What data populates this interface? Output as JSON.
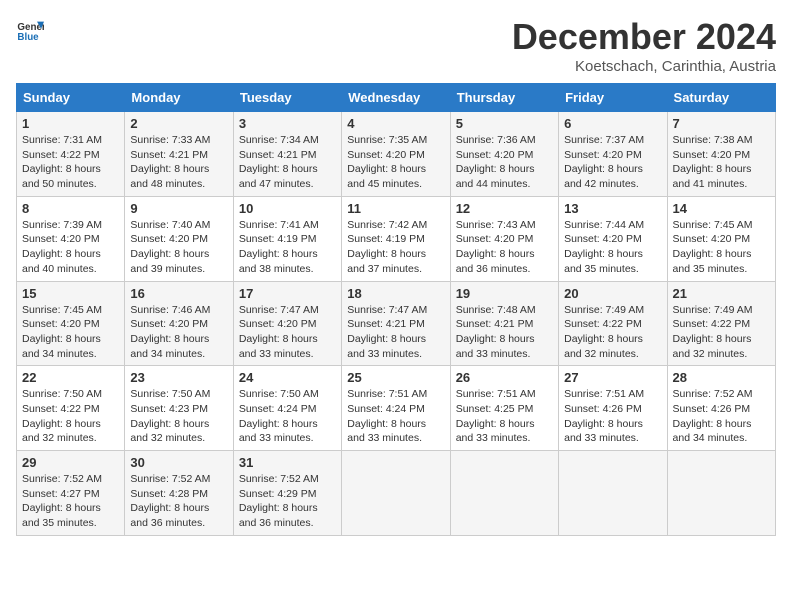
{
  "header": {
    "logo_text_general": "General",
    "logo_text_blue": "Blue",
    "month_title": "December 2024",
    "location": "Koetschach, Carinthia, Austria"
  },
  "days_of_week": [
    "Sunday",
    "Monday",
    "Tuesday",
    "Wednesday",
    "Thursday",
    "Friday",
    "Saturday"
  ],
  "weeks": [
    [
      {
        "day": "1",
        "rise": "Sunrise: 7:31 AM",
        "set": "Sunset: 4:22 PM",
        "daylight": "Daylight: 8 hours and 50 minutes."
      },
      {
        "day": "2",
        "rise": "Sunrise: 7:33 AM",
        "set": "Sunset: 4:21 PM",
        "daylight": "Daylight: 8 hours and 48 minutes."
      },
      {
        "day": "3",
        "rise": "Sunrise: 7:34 AM",
        "set": "Sunset: 4:21 PM",
        "daylight": "Daylight: 8 hours and 47 minutes."
      },
      {
        "day": "4",
        "rise": "Sunrise: 7:35 AM",
        "set": "Sunset: 4:20 PM",
        "daylight": "Daylight: 8 hours and 45 minutes."
      },
      {
        "day": "5",
        "rise": "Sunrise: 7:36 AM",
        "set": "Sunset: 4:20 PM",
        "daylight": "Daylight: 8 hours and 44 minutes."
      },
      {
        "day": "6",
        "rise": "Sunrise: 7:37 AM",
        "set": "Sunset: 4:20 PM",
        "daylight": "Daylight: 8 hours and 42 minutes."
      },
      {
        "day": "7",
        "rise": "Sunrise: 7:38 AM",
        "set": "Sunset: 4:20 PM",
        "daylight": "Daylight: 8 hours and 41 minutes."
      }
    ],
    [
      {
        "day": "8",
        "rise": "Sunrise: 7:39 AM",
        "set": "Sunset: 4:20 PM",
        "daylight": "Daylight: 8 hours and 40 minutes."
      },
      {
        "day": "9",
        "rise": "Sunrise: 7:40 AM",
        "set": "Sunset: 4:20 PM",
        "daylight": "Daylight: 8 hours and 39 minutes."
      },
      {
        "day": "10",
        "rise": "Sunrise: 7:41 AM",
        "set": "Sunset: 4:19 PM",
        "daylight": "Daylight: 8 hours and 38 minutes."
      },
      {
        "day": "11",
        "rise": "Sunrise: 7:42 AM",
        "set": "Sunset: 4:19 PM",
        "daylight": "Daylight: 8 hours and 37 minutes."
      },
      {
        "day": "12",
        "rise": "Sunrise: 7:43 AM",
        "set": "Sunset: 4:20 PM",
        "daylight": "Daylight: 8 hours and 36 minutes."
      },
      {
        "day": "13",
        "rise": "Sunrise: 7:44 AM",
        "set": "Sunset: 4:20 PM",
        "daylight": "Daylight: 8 hours and 35 minutes."
      },
      {
        "day": "14",
        "rise": "Sunrise: 7:45 AM",
        "set": "Sunset: 4:20 PM",
        "daylight": "Daylight: 8 hours and 35 minutes."
      }
    ],
    [
      {
        "day": "15",
        "rise": "Sunrise: 7:45 AM",
        "set": "Sunset: 4:20 PM",
        "daylight": "Daylight: 8 hours and 34 minutes."
      },
      {
        "day": "16",
        "rise": "Sunrise: 7:46 AM",
        "set": "Sunset: 4:20 PM",
        "daylight": "Daylight: 8 hours and 34 minutes."
      },
      {
        "day": "17",
        "rise": "Sunrise: 7:47 AM",
        "set": "Sunset: 4:20 PM",
        "daylight": "Daylight: 8 hours and 33 minutes."
      },
      {
        "day": "18",
        "rise": "Sunrise: 7:47 AM",
        "set": "Sunset: 4:21 PM",
        "daylight": "Daylight: 8 hours and 33 minutes."
      },
      {
        "day": "19",
        "rise": "Sunrise: 7:48 AM",
        "set": "Sunset: 4:21 PM",
        "daylight": "Daylight: 8 hours and 33 minutes."
      },
      {
        "day": "20",
        "rise": "Sunrise: 7:49 AM",
        "set": "Sunset: 4:22 PM",
        "daylight": "Daylight: 8 hours and 32 minutes."
      },
      {
        "day": "21",
        "rise": "Sunrise: 7:49 AM",
        "set": "Sunset: 4:22 PM",
        "daylight": "Daylight: 8 hours and 32 minutes."
      }
    ],
    [
      {
        "day": "22",
        "rise": "Sunrise: 7:50 AM",
        "set": "Sunset: 4:22 PM",
        "daylight": "Daylight: 8 hours and 32 minutes."
      },
      {
        "day": "23",
        "rise": "Sunrise: 7:50 AM",
        "set": "Sunset: 4:23 PM",
        "daylight": "Daylight: 8 hours and 32 minutes."
      },
      {
        "day": "24",
        "rise": "Sunrise: 7:50 AM",
        "set": "Sunset: 4:24 PM",
        "daylight": "Daylight: 8 hours and 33 minutes."
      },
      {
        "day": "25",
        "rise": "Sunrise: 7:51 AM",
        "set": "Sunset: 4:24 PM",
        "daylight": "Daylight: 8 hours and 33 minutes."
      },
      {
        "day": "26",
        "rise": "Sunrise: 7:51 AM",
        "set": "Sunset: 4:25 PM",
        "daylight": "Daylight: 8 hours and 33 minutes."
      },
      {
        "day": "27",
        "rise": "Sunrise: 7:51 AM",
        "set": "Sunset: 4:26 PM",
        "daylight": "Daylight: 8 hours and 33 minutes."
      },
      {
        "day": "28",
        "rise": "Sunrise: 7:52 AM",
        "set": "Sunset: 4:26 PM",
        "daylight": "Daylight: 8 hours and 34 minutes."
      }
    ],
    [
      {
        "day": "29",
        "rise": "Sunrise: 7:52 AM",
        "set": "Sunset: 4:27 PM",
        "daylight": "Daylight: 8 hours and 35 minutes."
      },
      {
        "day": "30",
        "rise": "Sunrise: 7:52 AM",
        "set": "Sunset: 4:28 PM",
        "daylight": "Daylight: 8 hours and 36 minutes."
      },
      {
        "day": "31",
        "rise": "Sunrise: 7:52 AM",
        "set": "Sunset: 4:29 PM",
        "daylight": "Daylight: 8 hours and 36 minutes."
      },
      null,
      null,
      null,
      null
    ]
  ]
}
